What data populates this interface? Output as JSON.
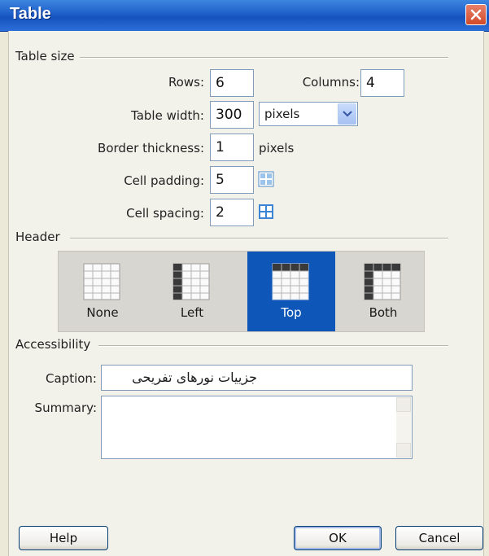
{
  "window": {
    "title": "Table"
  },
  "table_size": {
    "group_label": "Table size",
    "rows_label": "Rows:",
    "rows_value": "6",
    "columns_label": "Columns:",
    "columns_value": "4",
    "width_label": "Table width:",
    "width_value": "300",
    "width_unit": "pixels",
    "border_label": "Border thickness:",
    "border_value": "1",
    "border_unit": "pixels",
    "padding_label": "Cell padding:",
    "padding_value": "5",
    "spacing_label": "Cell spacing:",
    "spacing_value": "2"
  },
  "header": {
    "group_label": "Header",
    "options": [
      "None",
      "Left",
      "Top",
      "Both"
    ],
    "selected": "Top"
  },
  "accessibility": {
    "group_label": "Accessibility",
    "caption_label": "Caption:",
    "caption_value": "جزییات نورهای تفریحی",
    "summary_label": "Summary:",
    "summary_value": ""
  },
  "buttons": {
    "help": "Help",
    "ok": "OK",
    "cancel": "Cancel"
  },
  "colors": {
    "title_bar": "#1f5fc9",
    "selected": "#0e57b8",
    "close": "#d24a2a"
  }
}
